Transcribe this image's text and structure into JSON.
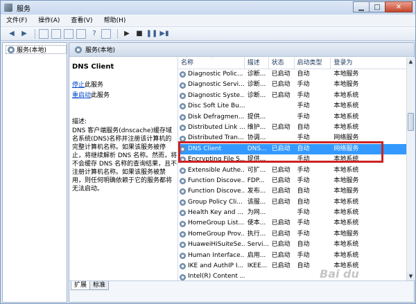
{
  "window": {
    "title": "服务"
  },
  "menu": [
    "文件(F)",
    "操作(A)",
    "查看(V)",
    "帮助(H)"
  ],
  "left_pane": {
    "tree_item": "服务(本地)"
  },
  "right_pane": {
    "header": "服务(本地)",
    "description": {
      "title": "DNS Client",
      "link_stop": "停止",
      "link_stop_suffix": "此服务",
      "link_restart": "重启动",
      "link_restart_suffix": "此服务",
      "label": "描述:",
      "text": "DNS 客户端服务(dnscache)缓存域名系统(DNS)名称并注册该计算机的完整计算机名称。如果该服务被停止，将继续解析 DNS 名称。然而，将不会缓存 DNS 名称的查询结果，且不注册计算机名称。如果该服务被禁用，则任何明确依赖于它的服务都将无法启动。"
    },
    "columns": [
      "名称",
      "描述",
      "状态",
      "启动类型",
      "登录为"
    ],
    "rows": [
      {
        "name": "Diagnostic Polic...",
        "desc": "诊断...",
        "status": "已启动",
        "start": "自动",
        "logon": "本地服务"
      },
      {
        "name": "Diagnostic Servi...",
        "desc": "诊断...",
        "status": "已启动",
        "start": "手动",
        "logon": "本地服务"
      },
      {
        "name": "Diagnostic Syste...",
        "desc": "诊断...",
        "status": "已启动",
        "start": "手动",
        "logon": "本地系统"
      },
      {
        "name": "Disc Soft Lite Bu...",
        "desc": "",
        "status": "",
        "start": "手动",
        "logon": "本地系统"
      },
      {
        "name": "Disk Defragmen...",
        "desc": "提供...",
        "status": "",
        "start": "手动",
        "logon": "本地系统"
      },
      {
        "name": "Distributed Link ...",
        "desc": "维护...",
        "status": "已启动",
        "start": "自动",
        "logon": "本地系统"
      },
      {
        "name": "Distributed Tran...",
        "desc": "协调...",
        "status": "",
        "start": "手动",
        "logon": "网络服务"
      },
      {
        "name": "DNS Client",
        "desc": "DNS...",
        "status": "已启动",
        "start": "自动",
        "logon": "网络服务"
      },
      {
        "name": "Encrypting File S...",
        "desc": "提供...",
        "status": "",
        "start": "手动",
        "logon": "本地系统"
      },
      {
        "name": "Extensible Authe...",
        "desc": "可扩...",
        "status": "已启动",
        "start": "手动",
        "logon": "本地系统"
      },
      {
        "name": "Function Discove...",
        "desc": "FDP...",
        "status": "已启动",
        "start": "手动",
        "logon": "本地服务"
      },
      {
        "name": "Function Discove...",
        "desc": "发布...",
        "status": "已启动",
        "start": "自动",
        "logon": "本地服务"
      },
      {
        "name": "Group Policy Cli...",
        "desc": "该服...",
        "status": "已启动",
        "start": "自动",
        "logon": "本地系统"
      },
      {
        "name": "Health Key and ...",
        "desc": "为网...",
        "status": "",
        "start": "手动",
        "logon": "本地系统"
      },
      {
        "name": "HomeGroup List...",
        "desc": "使本...",
        "status": "已启动",
        "start": "手动",
        "logon": "本地系统"
      },
      {
        "name": "HomeGroup Prov...",
        "desc": "执行...",
        "status": "已启动",
        "start": "手动",
        "logon": "本地服务"
      },
      {
        "name": "HuaweiHiSuiteSe...",
        "desc": "Servi...",
        "status": "已启动",
        "start": "自动",
        "logon": "本地系统"
      },
      {
        "name": "Human Interface...",
        "desc": "启用...",
        "status": "已启动",
        "start": "手动",
        "logon": "本地系统"
      },
      {
        "name": "IKE and AuthIP I...",
        "desc": "IKEE...",
        "status": "已启动",
        "start": "自动",
        "logon": "本地系统"
      },
      {
        "name": "Intel(R) Content ...",
        "desc": "",
        "status": "",
        "start": "",
        "logon": ""
      }
    ],
    "selected_index": 7,
    "tabs": [
      "扩展",
      "标准"
    ]
  },
  "watermark": "Bai du"
}
